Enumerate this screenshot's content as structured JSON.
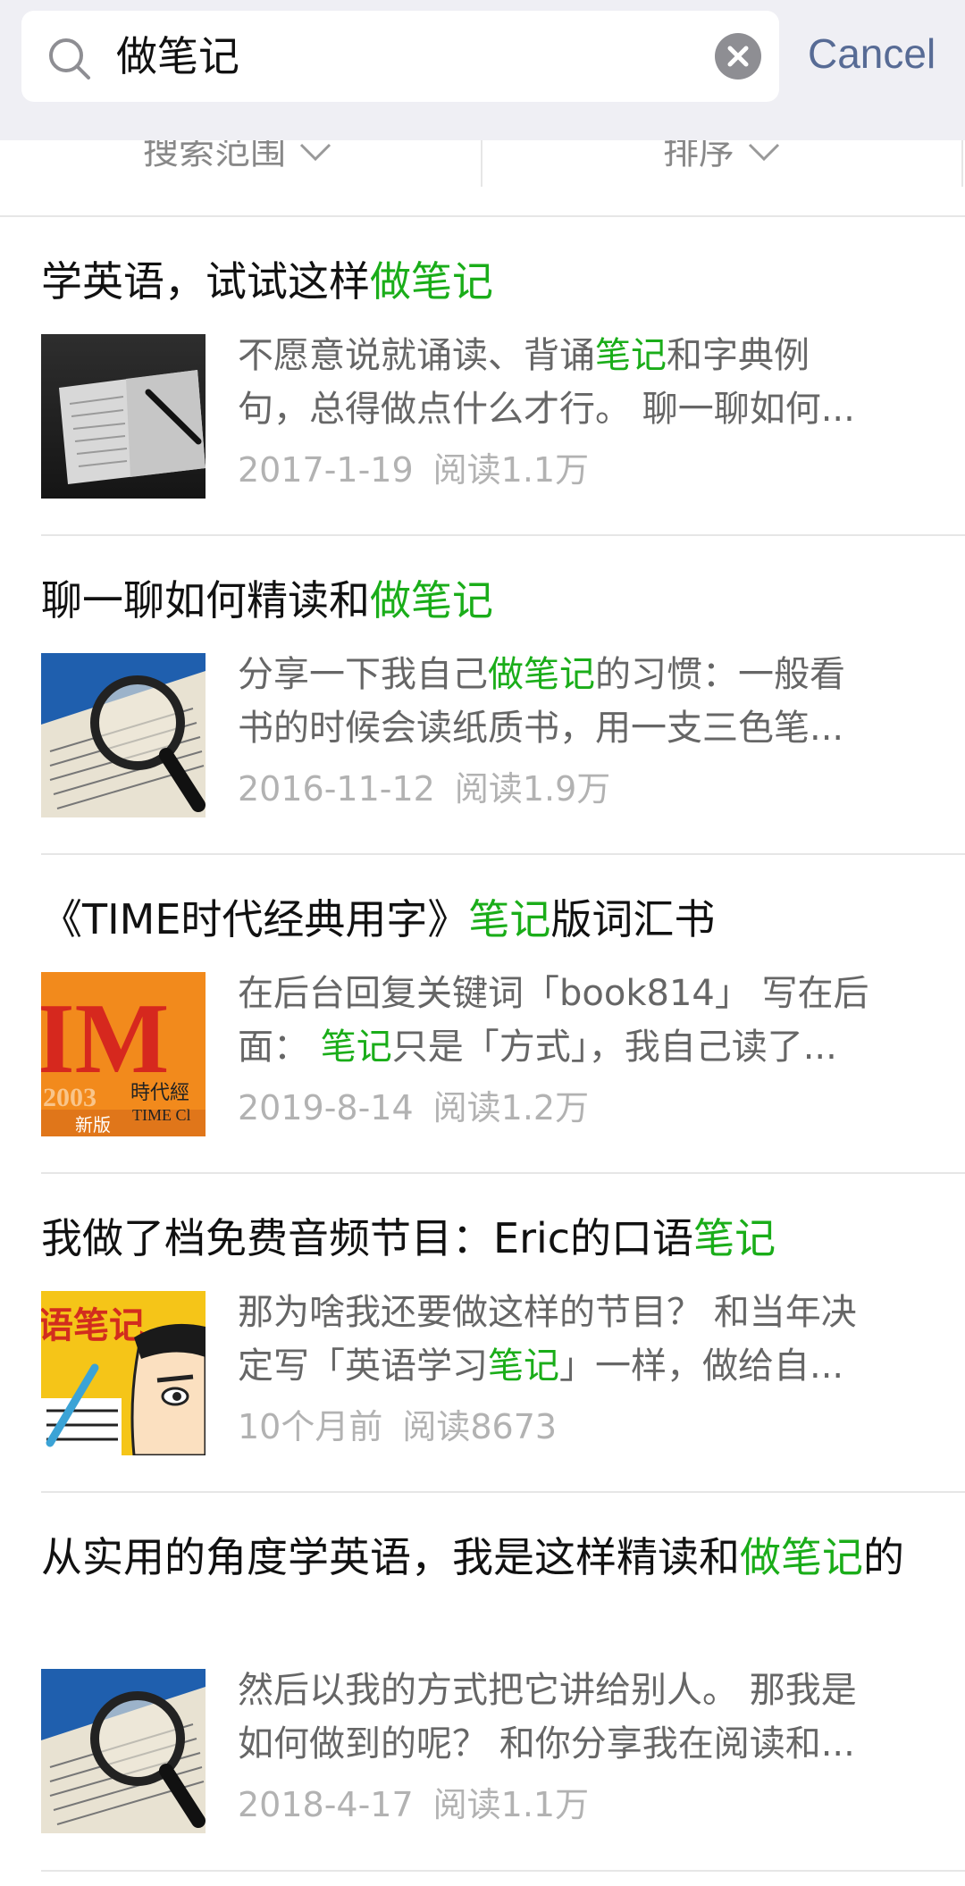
{
  "search": {
    "query": "做笔记",
    "cancel_label": "Cancel"
  },
  "filters": {
    "scope_label": "搜索范围",
    "sort_label": "排序"
  },
  "colors": {
    "highlight": "#1aad19",
    "link": "#576b95",
    "meta": "#b2b2b2"
  },
  "results": [
    {
      "title_pre": "学英语，试试这样",
      "title_hl": "做笔记",
      "title_post": "",
      "desc_line1_pre": "不愿意说就诵读、背诵",
      "desc_line1_hl": "笔记",
      "desc_line1_post": "和字典例",
      "desc_line2_pre": "句，总得做点什么才行。 聊一聊如何...",
      "desc_line2_hl": "",
      "desc_line2_post": "",
      "date": "2017-1-19",
      "reads": "阅读1.1万",
      "thumb_icon": "open-book-with-pen"
    },
    {
      "title_pre": "聊一聊如何精读和",
      "title_hl": "做笔记",
      "title_post": "",
      "desc_line1_pre": "分享一下我自己",
      "desc_line1_hl": "做笔记",
      "desc_line1_post": "的习惯：一般看",
      "desc_line2_pre": "书的时候会读纸质书，用一支三色笔...",
      "desc_line2_hl": "",
      "desc_line2_post": "",
      "date": "2016-11-12",
      "reads": "阅读1.9万",
      "thumb_icon": "magnifier-over-book"
    },
    {
      "title_pre": "《TIME时代经典用字》",
      "title_hl": "笔记",
      "title_post": "版词汇书",
      "desc_line1_pre": "在后台回复关键词「book814」 写在后",
      "desc_line1_hl": "",
      "desc_line1_post": "",
      "desc_line2_pre": "面： ",
      "desc_line2_hl": "笔记",
      "desc_line2_post": "只是「方式」，我自己读了...",
      "date": "2019-8-14",
      "reads": "阅读1.2万",
      "thumb_icon": "time-book-cover",
      "thumb_text": {
        "big": "IM",
        "year": "2003",
        "ed": "新版",
        "jp": "時代經",
        "en": "TIME Cl"
      }
    },
    {
      "title_pre": "我做了档免费音频节目：Eric的口语",
      "title_hl": "笔记",
      "title_post": "",
      "desc_line1_pre": "那为啥我还要做这样的节目？ 和当年决",
      "desc_line1_hl": "",
      "desc_line1_post": "",
      "desc_line2_pre": "定写「英语学习",
      "desc_line2_hl": "笔记",
      "desc_line2_post": "」一样，做给自...",
      "date": "10个月前",
      "reads": "阅读8673",
      "thumb_icon": "cartoon-notes-cover",
      "thumb_text": {
        "banner": "语笔记"
      }
    },
    {
      "title_pre": "从实用的角度学英语，我是这样精读和",
      "title_hl": "做笔记",
      "title_post": "的",
      "desc_line1_pre": "然后以我的方式把它讲给别人。 那我是",
      "desc_line1_hl": "",
      "desc_line1_post": "",
      "desc_line2_pre": "如何做到的呢？ 和你分享我在阅读和...",
      "desc_line2_hl": "",
      "desc_line2_post": "",
      "date": "2018-4-17",
      "reads": "阅读1.1万",
      "thumb_icon": "magnifier-over-book"
    }
  ]
}
